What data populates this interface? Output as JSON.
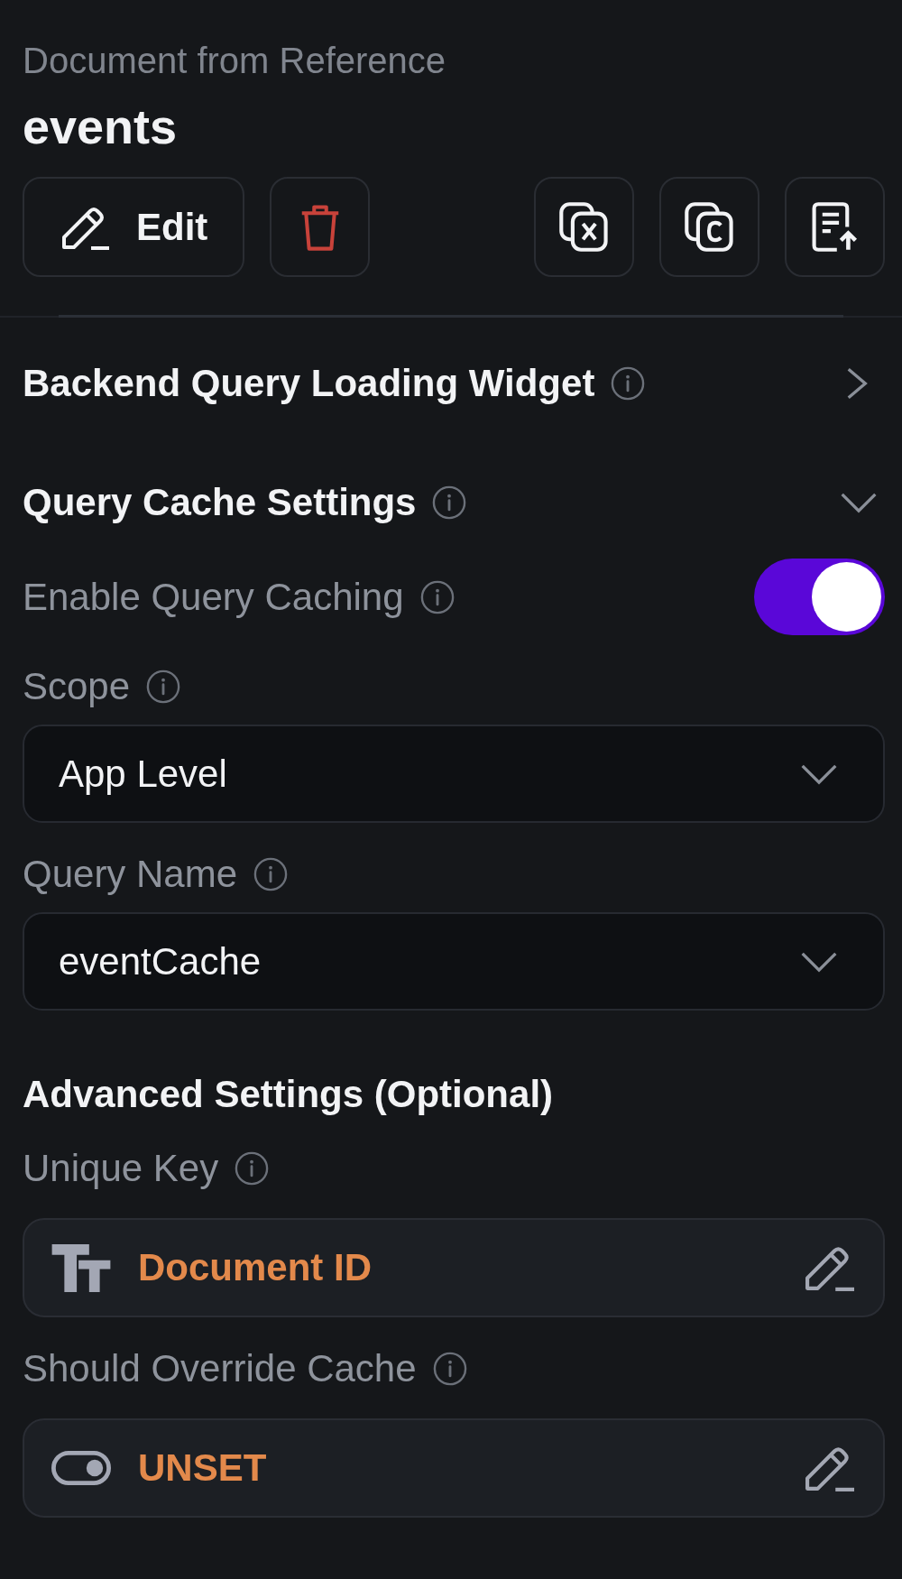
{
  "header": {
    "subtitle": "Document from Reference",
    "title": "events"
  },
  "toolbar": {
    "left": [
      {
        "kind": "edit",
        "label": "Edit"
      },
      {
        "kind": "delete"
      }
    ],
    "right": [
      {
        "kind": "variable"
      },
      {
        "kind": "copy"
      },
      {
        "kind": "export"
      }
    ]
  },
  "sections": [
    {
      "title": "Backend Query Loading Widget",
      "expanded": false
    },
    {
      "title": "Query Cache Settings",
      "expanded": true,
      "fields": [
        {
          "kind": "toggle",
          "label": "Enable Query Caching",
          "on": true
        },
        {
          "kind": "dropdown",
          "label": "Scope",
          "value": "App Level"
        },
        {
          "kind": "dropdown",
          "label": "Query Name",
          "value": "eventCache"
        },
        {
          "kind": "heading",
          "label": "Advanced Settings (Optional)"
        },
        {
          "kind": "text",
          "label": "Unique Key",
          "value": "Document ID"
        },
        {
          "kind": "boolean",
          "label": "Should Override Cache",
          "value": "UNSET"
        }
      ]
    }
  ]
}
